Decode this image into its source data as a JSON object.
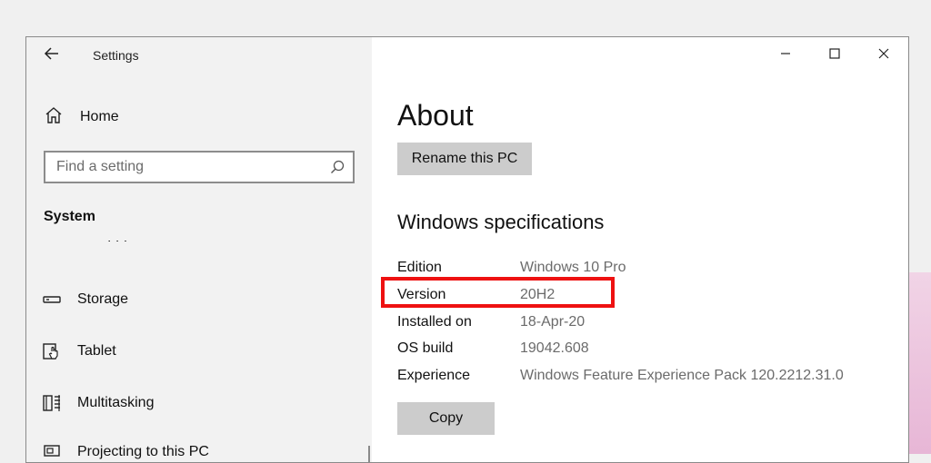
{
  "window": {
    "title": "Settings",
    "controls": {
      "minimize": "minimize",
      "maximize": "maximize",
      "close": "close"
    }
  },
  "sidebar": {
    "home_label": "Home",
    "search": {
      "placeholder": "Find a setting"
    },
    "section": "System",
    "items": [
      {
        "label": "Storage",
        "icon": "storage-icon"
      },
      {
        "label": "Tablet",
        "icon": "tablet-icon"
      },
      {
        "label": "Multitasking",
        "icon": "multitasking-icon"
      },
      {
        "label": "Projecting to this PC",
        "icon": "projecting-icon"
      }
    ]
  },
  "main": {
    "title": "About",
    "rename_button": "Rename this PC",
    "specs_heading": "Windows specifications",
    "specs": [
      {
        "key": "Edition",
        "value": "Windows 10 Pro"
      },
      {
        "key": "Version",
        "value": "20H2"
      },
      {
        "key": "Installed on",
        "value": "18-Apr-20"
      },
      {
        "key": "OS build",
        "value": "19042.608"
      },
      {
        "key": "Experience",
        "value": "Windows Feature Experience Pack 120.2212.31.0"
      }
    ],
    "copy_button": "Copy"
  },
  "colors": {
    "highlight": "#ee1111",
    "sidebar_bg": "#f2f2f2",
    "button_bg": "#cccccc"
  }
}
